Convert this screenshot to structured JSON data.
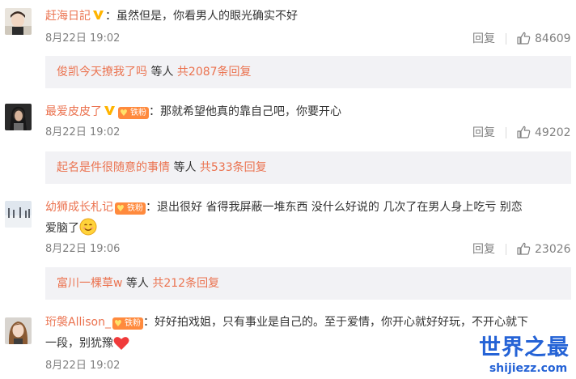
{
  "comments": [
    {
      "user": "赶海日記",
      "verified": true,
      "fan_badge": null,
      "text": "虽然但是，你看男人的眼光确实不好",
      "text2": "",
      "time": "8月22日 19:02",
      "reply_label": "回复",
      "likes": "84609",
      "sub_name": "俊凯今天撩我了吗",
      "sub_mid": " 等人 ",
      "sub_total": "共2087条回复"
    },
    {
      "user": "最爱皮皮了",
      "verified": true,
      "fan_badge": "铁粉",
      "text": "那就希望他真的靠自己吧，你要开心",
      "text2": "",
      "time": "8月22日 19:02",
      "reply_label": "回复",
      "likes": "49202",
      "sub_name": "起名是件很随意的事情",
      "sub_mid": " 等人 ",
      "sub_total": "共533条回复"
    },
    {
      "user": "幼狮成长札记",
      "verified": false,
      "fan_badge": "铁粉",
      "text": "退出很好 省得我屏蔽一堆东西 没什么好说的 几次了在男人身上吃亏 别恋",
      "text2": "爱脑了",
      "time": "8月22日 19:06",
      "reply_label": "回复",
      "likes": "23026",
      "sub_name": "富川一棵草w",
      "sub_mid": " 等人 ",
      "sub_total": "共212条回复"
    },
    {
      "user": "珩褩Allison_",
      "verified": false,
      "fan_badge": "铁粉",
      "text": "好好拍戏姐，只有事业是自己的。至于爱情，你开心就好好玩，不开心就下",
      "text2": "一段，别犹豫",
      "time": "8月22日 19:02",
      "reply_label": "",
      "likes": "",
      "sub_name": "",
      "sub_mid": "",
      "sub_total": ""
    }
  ],
  "colon": "：",
  "icons": {
    "verified": "verified-v-icon",
    "like": "thumbs-up-icon",
    "smile": "smile-emoji-icon",
    "heart": "red-heart-emoji-icon"
  },
  "colors": {
    "username": "#eb7350",
    "muted": "#808080",
    "sub_bg": "#f2f2f5",
    "badge": "#ff8a3d",
    "verified": "#ffb400",
    "watermark": "#2563d6"
  },
  "watermark": {
    "title": "世界之最",
    "url": "shijiezz.com"
  }
}
